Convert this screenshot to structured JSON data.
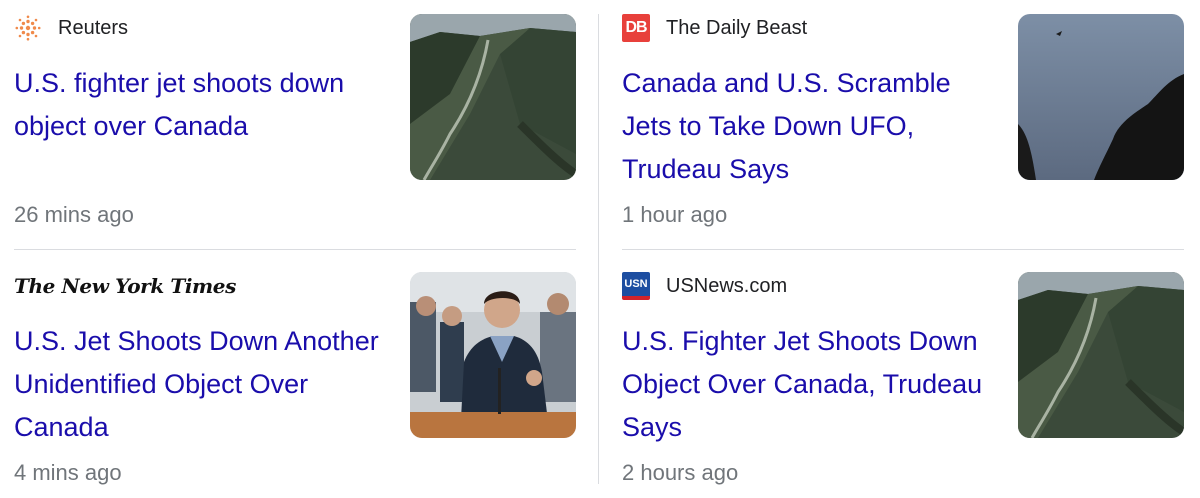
{
  "articles": [
    {
      "source": "Reuters",
      "source_icon": "reuters-logo-icon",
      "headline": "U.S. fighter jet shoots down object over Canada",
      "time": "26 mins ago",
      "thumbnail": "mountain-valley-aerial"
    },
    {
      "source": "The Daily Beast",
      "source_icon": "daily-beast-logo-icon",
      "logo_text": "DB",
      "headline": "Canada and U.S. Scramble Jets to Take Down UFO, Trudeau Says",
      "time": "1 hour ago",
      "thumbnail": "dusk-sky-object"
    },
    {
      "source": "The New York Times",
      "source_icon": "nyt-logo-icon",
      "headline": "U.S. Jet Shoots Down Another Unidentified Object Over Canada",
      "time": "4 mins ago",
      "thumbnail": "trudeau-podium"
    },
    {
      "source": "USNews.com",
      "source_icon": "usnews-logo-icon",
      "logo_text": "USN",
      "headline": "U.S. Fighter Jet Shoots Down Object Over Canada, Trudeau Says",
      "time": "2 hours ago",
      "thumbnail": "mountain-valley-aerial"
    }
  ],
  "colors": {
    "headline": "#1a0dab",
    "source": "#202124",
    "time": "#70757a",
    "divider": "#dadce0",
    "reuters_orange": "#f08a4b",
    "daily_beast_red": "#e8403b",
    "usnews_blue": "#1d4ea1"
  }
}
